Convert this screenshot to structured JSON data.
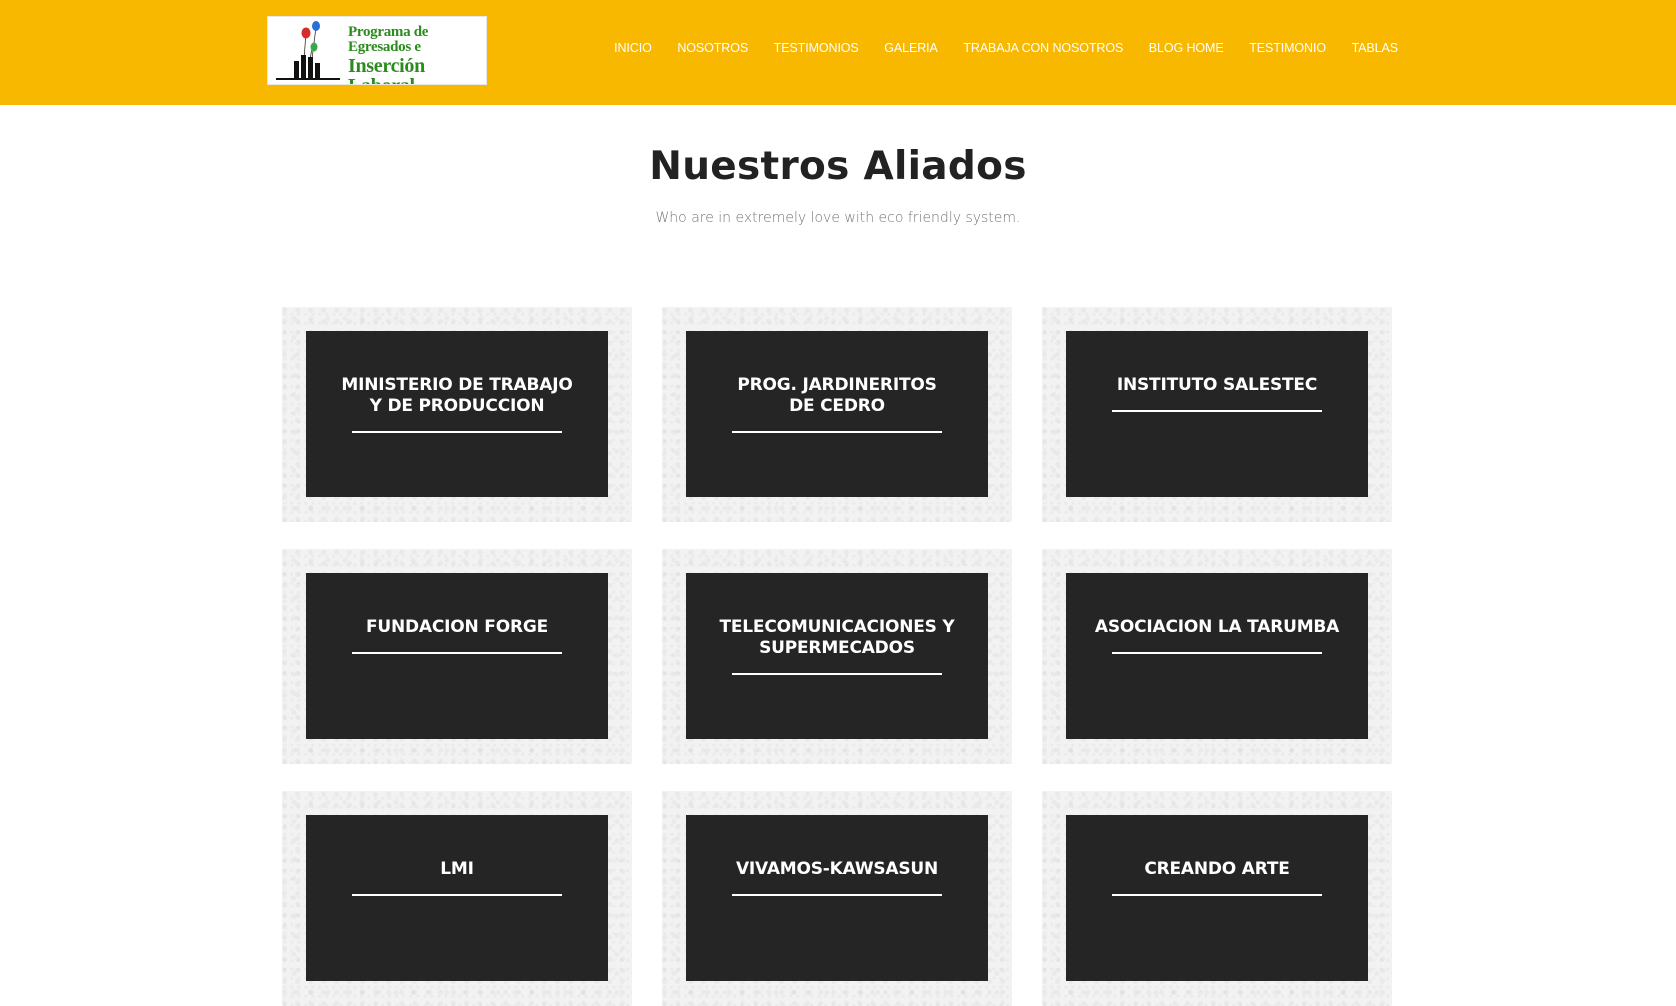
{
  "header": {
    "logo": {
      "line1": "Programa de Egresados e",
      "line2": "Inserción Laboral"
    },
    "nav": [
      "INICIO",
      "NOSOTROS",
      "TESTIMONIOS",
      "GALERIA",
      "TRABAJA CON NOSOTROS",
      "BLOG HOME",
      "TESTIMONIO",
      "TABLAS"
    ]
  },
  "section": {
    "title": "Nuestros Aliados",
    "subtitle": "Who are in extremely love with eco friendly system."
  },
  "allies": [
    {
      "line1": "MINISTERIO DE TRABAJO",
      "line2": "Y DE PRODUCCION"
    },
    {
      "line1": "PROG. JARDINERITOS",
      "line2": "DE CEDRO"
    },
    {
      "line1": "INSTITUTO SALESTEC",
      "line2": ""
    },
    {
      "line1": "FUNDACION FORGE",
      "line2": ""
    },
    {
      "line1": "TELECOMUNICACIONES Y",
      "line2": "SUPERMECADOS"
    },
    {
      "line1": "ASOCIACION LA TARUMBA",
      "line2": ""
    },
    {
      "line1": "LMI",
      "line2": ""
    },
    {
      "line1": "VIVAMOS-KAWSASUN",
      "line2": ""
    },
    {
      "line1": "CREANDO ARTE",
      "line2": ""
    }
  ],
  "colors": {
    "header_bg": "#f9b800",
    "card_bg": "#252525",
    "card_frame": "#f2f2f2",
    "logo_text": "#2c8b1e"
  }
}
